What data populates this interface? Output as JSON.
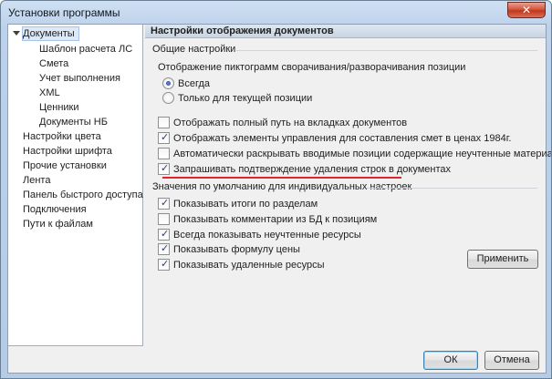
{
  "window": {
    "title": "Установки программы",
    "close_glyph": "✕"
  },
  "tree": {
    "items": [
      {
        "label": "Документы",
        "level": 0,
        "expanded": true,
        "selected": true
      },
      {
        "label": "Шаблон расчета ЛС",
        "level": 1
      },
      {
        "label": "Смета",
        "level": 1
      },
      {
        "label": "Учет выполнения",
        "level": 1
      },
      {
        "label": "XML",
        "level": 1
      },
      {
        "label": "Ценники",
        "level": 1
      },
      {
        "label": "Документы НБ",
        "level": 1
      },
      {
        "label": "Настройки цвета",
        "level": 0
      },
      {
        "label": "Настройки шрифта",
        "level": 0
      },
      {
        "label": "Прочие установки",
        "level": 0
      },
      {
        "label": "Лента",
        "level": 0
      },
      {
        "label": "Панель быстрого доступа",
        "level": 0
      },
      {
        "label": "Подключения",
        "level": 0
      },
      {
        "label": "Пути к файлам",
        "level": 0
      }
    ]
  },
  "panel": {
    "header": "Настройки отображения документов",
    "general": {
      "title": "Общие настройки",
      "icons_label": "Отображение пиктограмм сворачивания/разворачивания позиции",
      "radios": [
        {
          "label": "Всегда",
          "selected": true
        },
        {
          "label": "Только для текущей позиции",
          "selected": false
        }
      ],
      "checkboxes": [
        {
          "label": "Отображать полный путь на вкладках документов",
          "checked": false
        },
        {
          "label": "Отображать элементы управления для составления смет в ценах 1984г.",
          "checked": true
        },
        {
          "label": "Автоматически раскрывать вводимые позиции содержащие неучтенные материалы",
          "checked": false
        },
        {
          "label": "Запрашивать подтверждение удаления строк в документах",
          "checked": true
        }
      ]
    },
    "defaults": {
      "title": "Значения по умолчанию для индивидуальных настроек",
      "checkboxes": [
        {
          "label": "Показывать итоги по разделам",
          "checked": true
        },
        {
          "label": "Показывать комментарии из БД к позициям",
          "checked": false
        },
        {
          "label": "Всегда показывать неучтенные ресурсы",
          "checked": true
        },
        {
          "label": "Показывать формулу цены",
          "checked": true
        },
        {
          "label": "Показывать удаленные ресурсы",
          "checked": true
        }
      ],
      "apply_label": "Применить"
    }
  },
  "footer": {
    "ok_label": "ОК",
    "cancel_label": "Отмена"
  },
  "colors": {
    "highlight_line": "#e0242d",
    "selection": "#dce9f8"
  },
  "icons": {
    "check": "✓",
    "expander": "chevron-down-icon"
  }
}
